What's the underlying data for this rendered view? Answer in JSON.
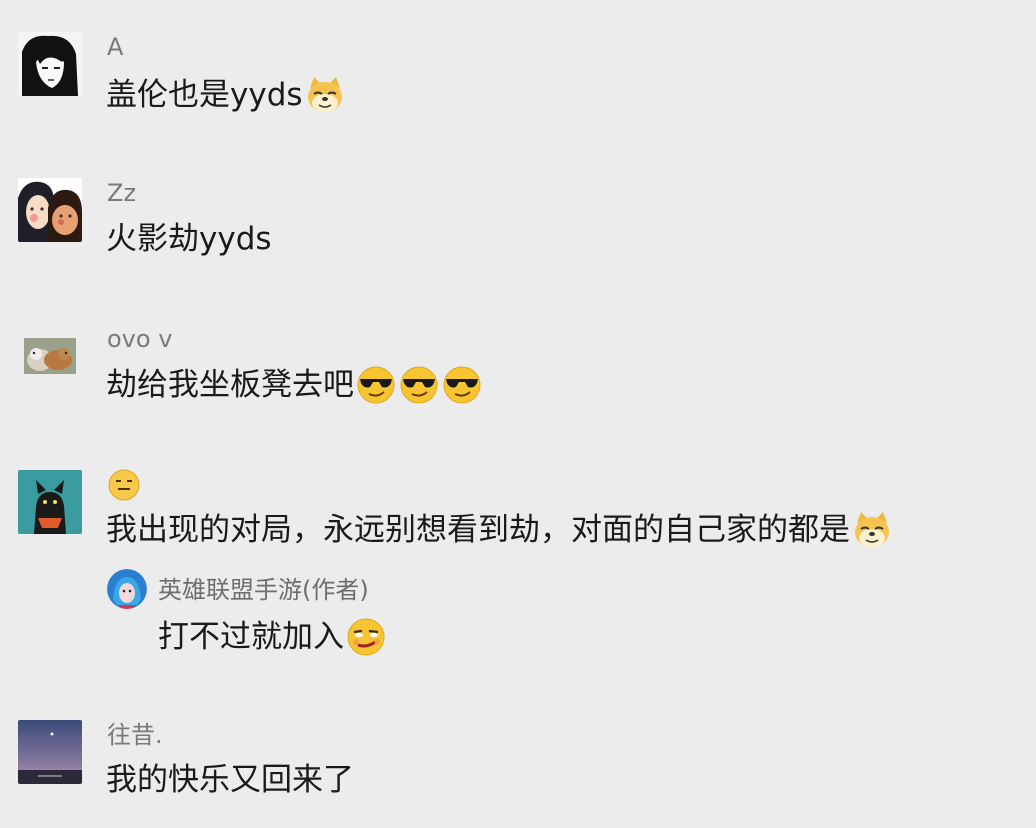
{
  "comments": [
    {
      "username": "A",
      "message": "盖伦也是yyds",
      "emojis": [
        "doge-icon"
      ]
    },
    {
      "username": "Zz",
      "message": "火影劫yyds",
      "emojis": []
    },
    {
      "username": "ovo v",
      "message": "劫给我坐板凳去吧",
      "emojis": [
        "sunglasses-smirk-icon",
        "sunglasses-smirk-icon",
        "sunglasses-smirk-icon"
      ]
    },
    {
      "username_emoji": "expressionless-face-icon",
      "message": "我出现的对局，永远别想看到劫，对面的自己家的都是",
      "emojis": [
        "doge-icon"
      ],
      "reply": {
        "username": "英雄联盟手游(作者)",
        "message": "打不过就加入",
        "emojis": [
          "smirk-face-icon"
        ]
      }
    },
    {
      "username": "往昔.",
      "message": "我的快乐又回来了",
      "emojis": []
    }
  ],
  "colors": {
    "background": "#ececec",
    "username": "#7a7a7a",
    "message": "#1a1a1a"
  }
}
